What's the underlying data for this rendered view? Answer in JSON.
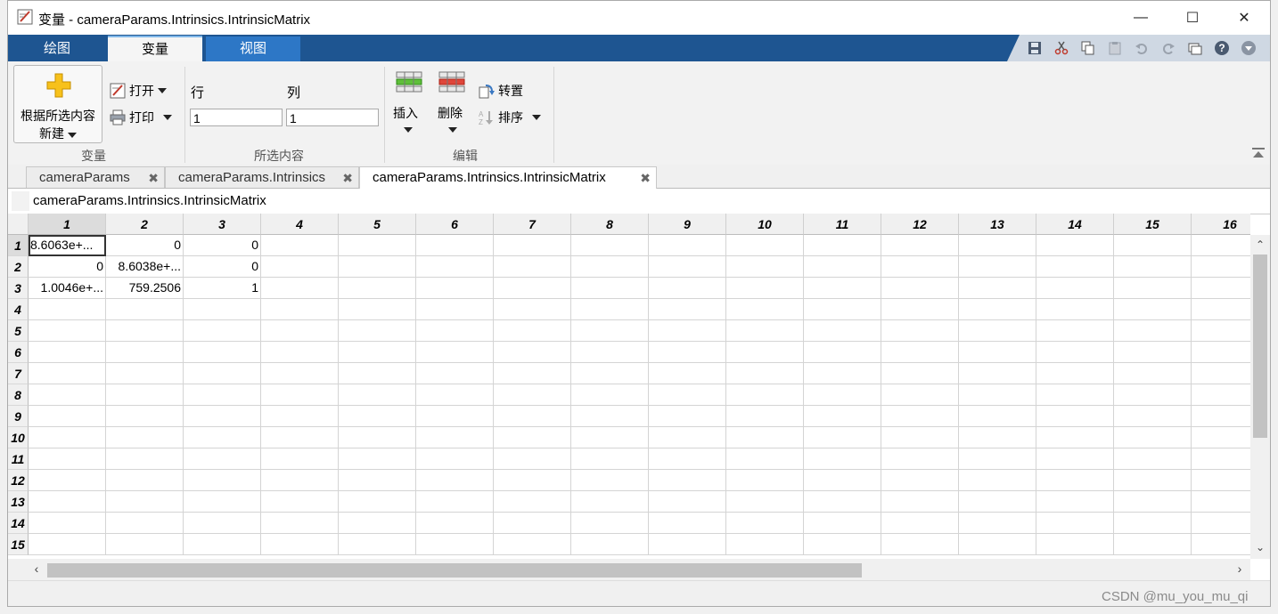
{
  "window": {
    "title": "变量 - cameraParams.Intrinsics.IntrinsicMatrix",
    "minimize": "—",
    "maximize": "☐",
    "close": "✕"
  },
  "ribbon_tabs": [
    "绘图",
    "变量",
    "视图"
  ],
  "active_ribbon_tab": "变量",
  "quick_access": [
    "save-icon",
    "cut-icon",
    "copy-icon",
    "paste-icon",
    "undo-icon",
    "redo-icon",
    "switch-windows-icon",
    "help-icon",
    "collapse-icon"
  ],
  "ribbon": {
    "variable_group": {
      "new_from_selection_line1": "根据所选内容",
      "new_from_selection_line2": "新建",
      "open": "打开",
      "print": "打印",
      "label": "变量"
    },
    "selection_group": {
      "row_label": "行",
      "col_label": "列",
      "row_value": "1",
      "col_value": "1",
      "label": "所选内容"
    },
    "edit_group": {
      "insert": "插入",
      "delete": "删除",
      "transpose": "转置",
      "sort": "排序",
      "label": "编辑"
    }
  },
  "doc_tabs": [
    {
      "label": "cameraParams",
      "active": false
    },
    {
      "label": "cameraParams.Intrinsics",
      "active": false
    },
    {
      "label": "cameraParams.Intrinsics.IntrinsicMatrix",
      "active": true
    }
  ],
  "variable_path": "cameraParams.Intrinsics.IntrinsicMatrix",
  "grid": {
    "column_headers": [
      "1",
      "2",
      "3",
      "4",
      "5",
      "6",
      "7",
      "8",
      "9",
      "10",
      "11",
      "12",
      "13",
      "14",
      "15",
      "16"
    ],
    "row_headers": [
      "1",
      "2",
      "3",
      "4",
      "5",
      "6",
      "7",
      "8",
      "9",
      "10",
      "11",
      "12",
      "13",
      "14",
      "15"
    ],
    "cells": [
      [
        "8.6063e+...",
        "0",
        "0"
      ],
      [
        "0",
        "8.6038e+...",
        "0"
      ],
      [
        "1.0046e+...",
        "759.2506",
        "1"
      ]
    ],
    "selected_cell": "1,1"
  },
  "watermark": "CSDN @mu_you_mu_qi"
}
